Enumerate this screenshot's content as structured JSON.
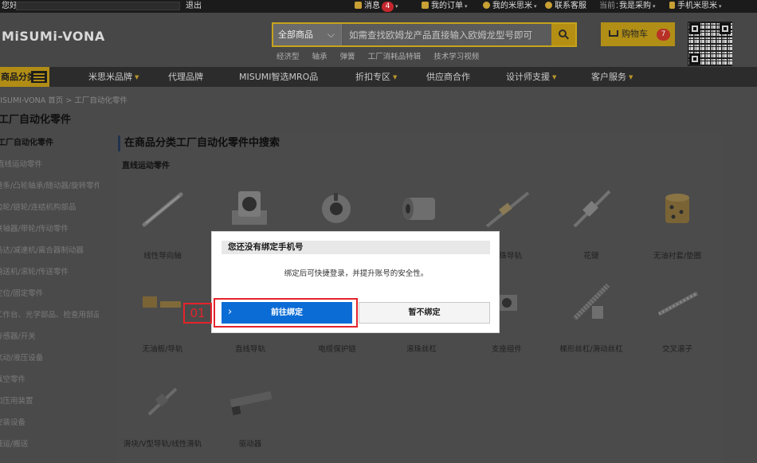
{
  "topbar": {
    "left_text": "您好",
    "logout": "退出",
    "messages": "消息",
    "messages_count": "4",
    "orders": "我的订单",
    "my_account": "我的米思米",
    "contact": "联系客服",
    "current_label": "当前：",
    "current_value": "我是采购",
    "mobile": "手机米思米"
  },
  "header": {
    "logo": "MiSUMi-VONA",
    "search_category": "全部商品",
    "search_placeholder": "如需查找欧姆龙产品直接输入欧姆龙型号即可",
    "hotwords": [
      "经济型",
      "轴承",
      "弹簧",
      "工厂消耗品特辑",
      "技术学习视频"
    ],
    "cart_label": "购物车",
    "cart_count": "7"
  },
  "nav": {
    "category_label": "商品分类",
    "items": [
      {
        "label": "米思米品牌",
        "has_menu": true
      },
      {
        "label": "代理品牌",
        "has_menu": false
      },
      {
        "label": "MISUMI智选MRO品",
        "has_menu": false
      },
      {
        "label": "折扣专区",
        "has_menu": true
      },
      {
        "label": "供应商合作",
        "has_menu": false
      },
      {
        "label": "设计师支援",
        "has_menu": true
      },
      {
        "label": "客户服务",
        "has_menu": true
      }
    ]
  },
  "breadcrumb": {
    "home": "MISUMI-VONA 首页",
    "separator": ">",
    "current": "工厂自动化零件"
  },
  "page_title": "工厂自动化零件",
  "sidebar": {
    "heading": "工厂自动化零件",
    "items": [
      "直线运动零件",
      "链条/凸轮轴承/随动器/旋转零件",
      "齿轮/链轮/连结机构部品",
      "联轴器/带轮/传动零件",
      "马达/减速机/离合器制动器",
      "输送机/滚轮/传送零件",
      "定位/固定零件",
      "工作台、光学部品、检查用部品",
      "传感器/开关",
      "气动/液压设备",
      "真空零件",
      "加压用装置",
      "安装设备",
      "搬运/搬送"
    ]
  },
  "main": {
    "title": "在商品分类工厂自动化零件中搜索",
    "subtitle": "直线运动零件",
    "products": [
      {
        "name": "线性导向轴",
        "icon": "shaft-image"
      },
      {
        "name": "",
        "icon": "shaft-holder-image"
      },
      {
        "name": "",
        "icon": "shaft-collar-image"
      },
      {
        "name": "",
        "icon": "linear-bushing-image"
      },
      {
        "name": "滚珠导轨",
        "icon": "linear-guide-image"
      },
      {
        "name": "花键",
        "icon": "ball-spline-image"
      },
      {
        "name": "无油衬套/垫圈",
        "icon": "oilless-bushing-image"
      },
      {
        "name": "无油板/导轨",
        "icon": "oilless-plate-image"
      },
      {
        "name": "直线导轨",
        "icon": "rail-image"
      },
      {
        "name": "电缆保护链",
        "icon": "cable-carrier-image"
      },
      {
        "name": "滚珠丝杠",
        "icon": "ball-screw-image"
      },
      {
        "name": "支座组件",
        "icon": "support-unit-image"
      },
      {
        "name": "梯形丝杠/滑动丝杠",
        "icon": "lead-screw-image"
      },
      {
        "name": "交叉滚子",
        "icon": "cross-roller-image"
      },
      {
        "name": "滑块/V型导轨/线性滑轨",
        "icon": "slide-image"
      },
      {
        "name": "驱动器",
        "icon": "actuator-image"
      }
    ]
  },
  "dialog": {
    "title": "您还没有绑定手机号",
    "message": "绑定后可快捷登录，并提升账号的安全性。",
    "bind_button": "前往绑定",
    "skip_button": "暂不绑定"
  },
  "annotation": {
    "step": "01"
  },
  "colors": {
    "accent_gold": "#b18d16",
    "primary_blue": "#0b6cd6",
    "highlight_red": "#e5232b",
    "overlay_gray": "#4a4a4a"
  }
}
